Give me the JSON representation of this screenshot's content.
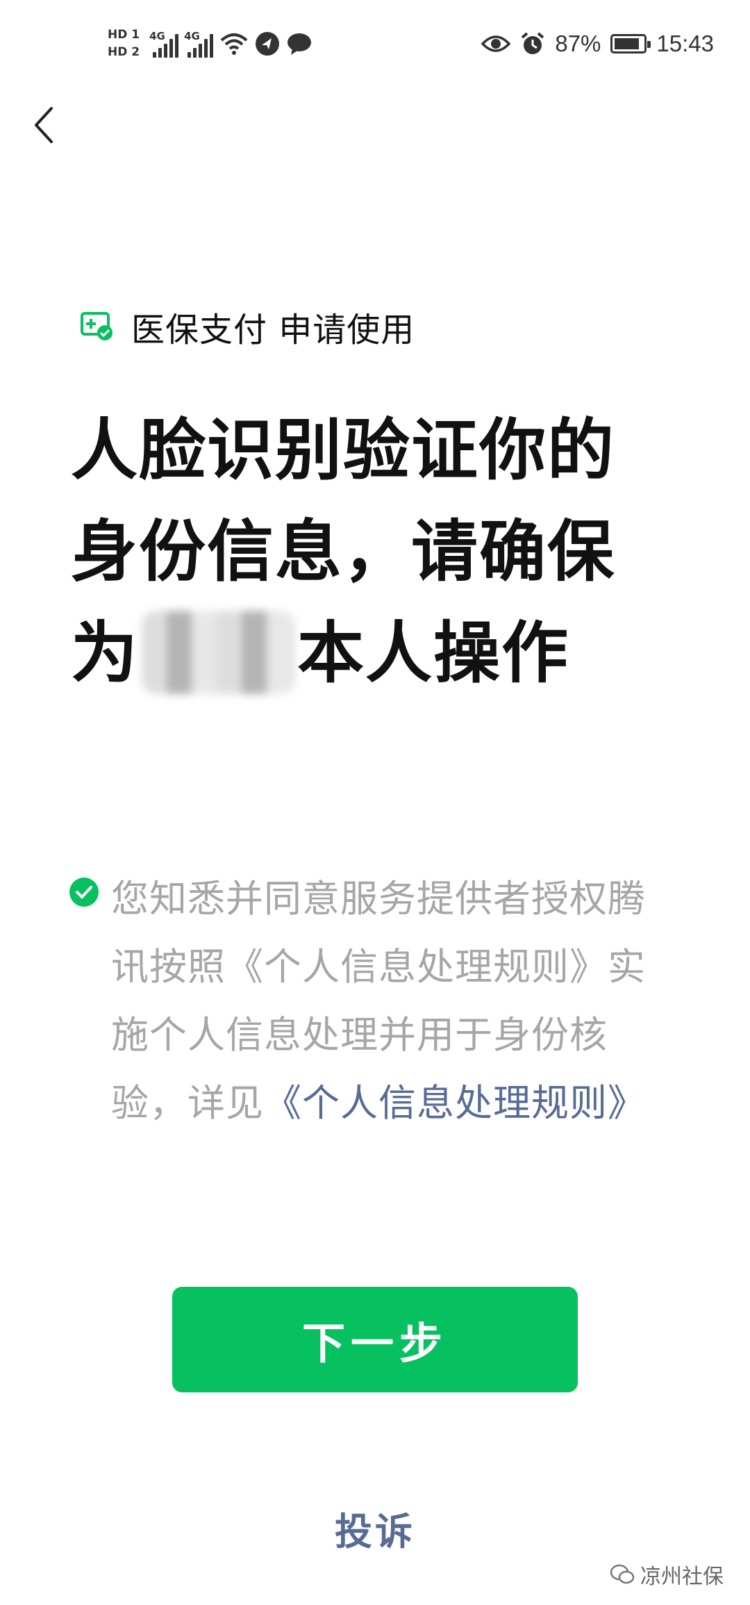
{
  "status_bar": {
    "hd1": "HD 1",
    "hd2": "HD 2",
    "net1": "4G",
    "net2": "4G",
    "battery_percent": "87%",
    "battery_level": 0.87,
    "time": "15:43"
  },
  "nav": {
    "back_icon": "chevron-left-icon"
  },
  "service": {
    "icon": "medical-card-check-icon",
    "label": "医保支付 申请使用"
  },
  "headline": {
    "line1": "人脸识别验证你的",
    "line2": "身份信息，请确保",
    "line3_prefix": "为",
    "line3_suffix": "本人操作"
  },
  "consent": {
    "text": "您知悉并同意服务提供者授权腾讯按照《个人信息处理规则》实施个人信息处理并用于身份核验，详见",
    "link": "《个人信息处理规则》"
  },
  "next_button": "下一步",
  "complaint_link": "投诉",
  "watermark": "凉州社保",
  "colors": {
    "accent": "#07c160",
    "link": "#576b95",
    "muted": "#a6a6a6"
  }
}
